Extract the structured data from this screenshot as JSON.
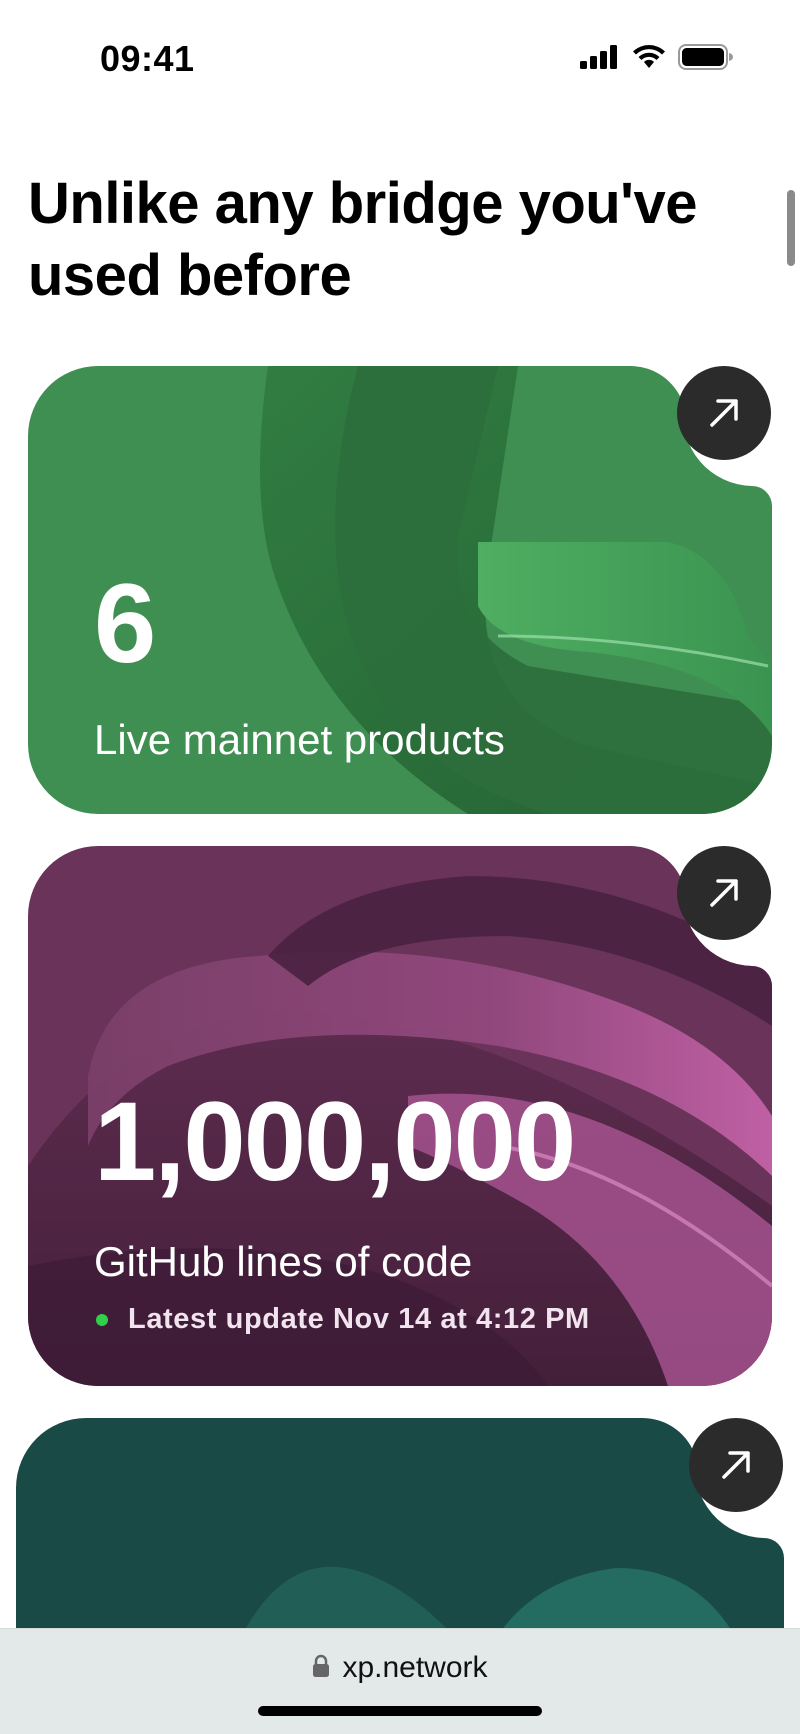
{
  "status_bar": {
    "time": "09:41",
    "icons": [
      "signal-icon",
      "wifi-icon",
      "battery-icon"
    ]
  },
  "heading": "Unlike any bridge you've used before",
  "cards": [
    {
      "number": "6",
      "label": "Live mainnet products",
      "color": "#3f8f52",
      "action_icon": "arrow-up-right-icon"
    },
    {
      "number": "1,000,000",
      "label": "GitHub lines of code",
      "update": "Latest update Nov 14 at 4:12 PM",
      "color": "#6a3359",
      "action_icon": "arrow-up-right-icon"
    },
    {
      "color": "#1a4a45",
      "action_icon": "arrow-up-right-icon"
    }
  ],
  "url_bar": {
    "url": "xp.network",
    "icon": "lock-icon"
  },
  "colors": {
    "green_card": "#3f8f52",
    "purple_card": "#6a3359",
    "teal_card": "#1a4a45",
    "arrow_button": "#2b2b2b",
    "status_dot": "#2fd14b"
  }
}
